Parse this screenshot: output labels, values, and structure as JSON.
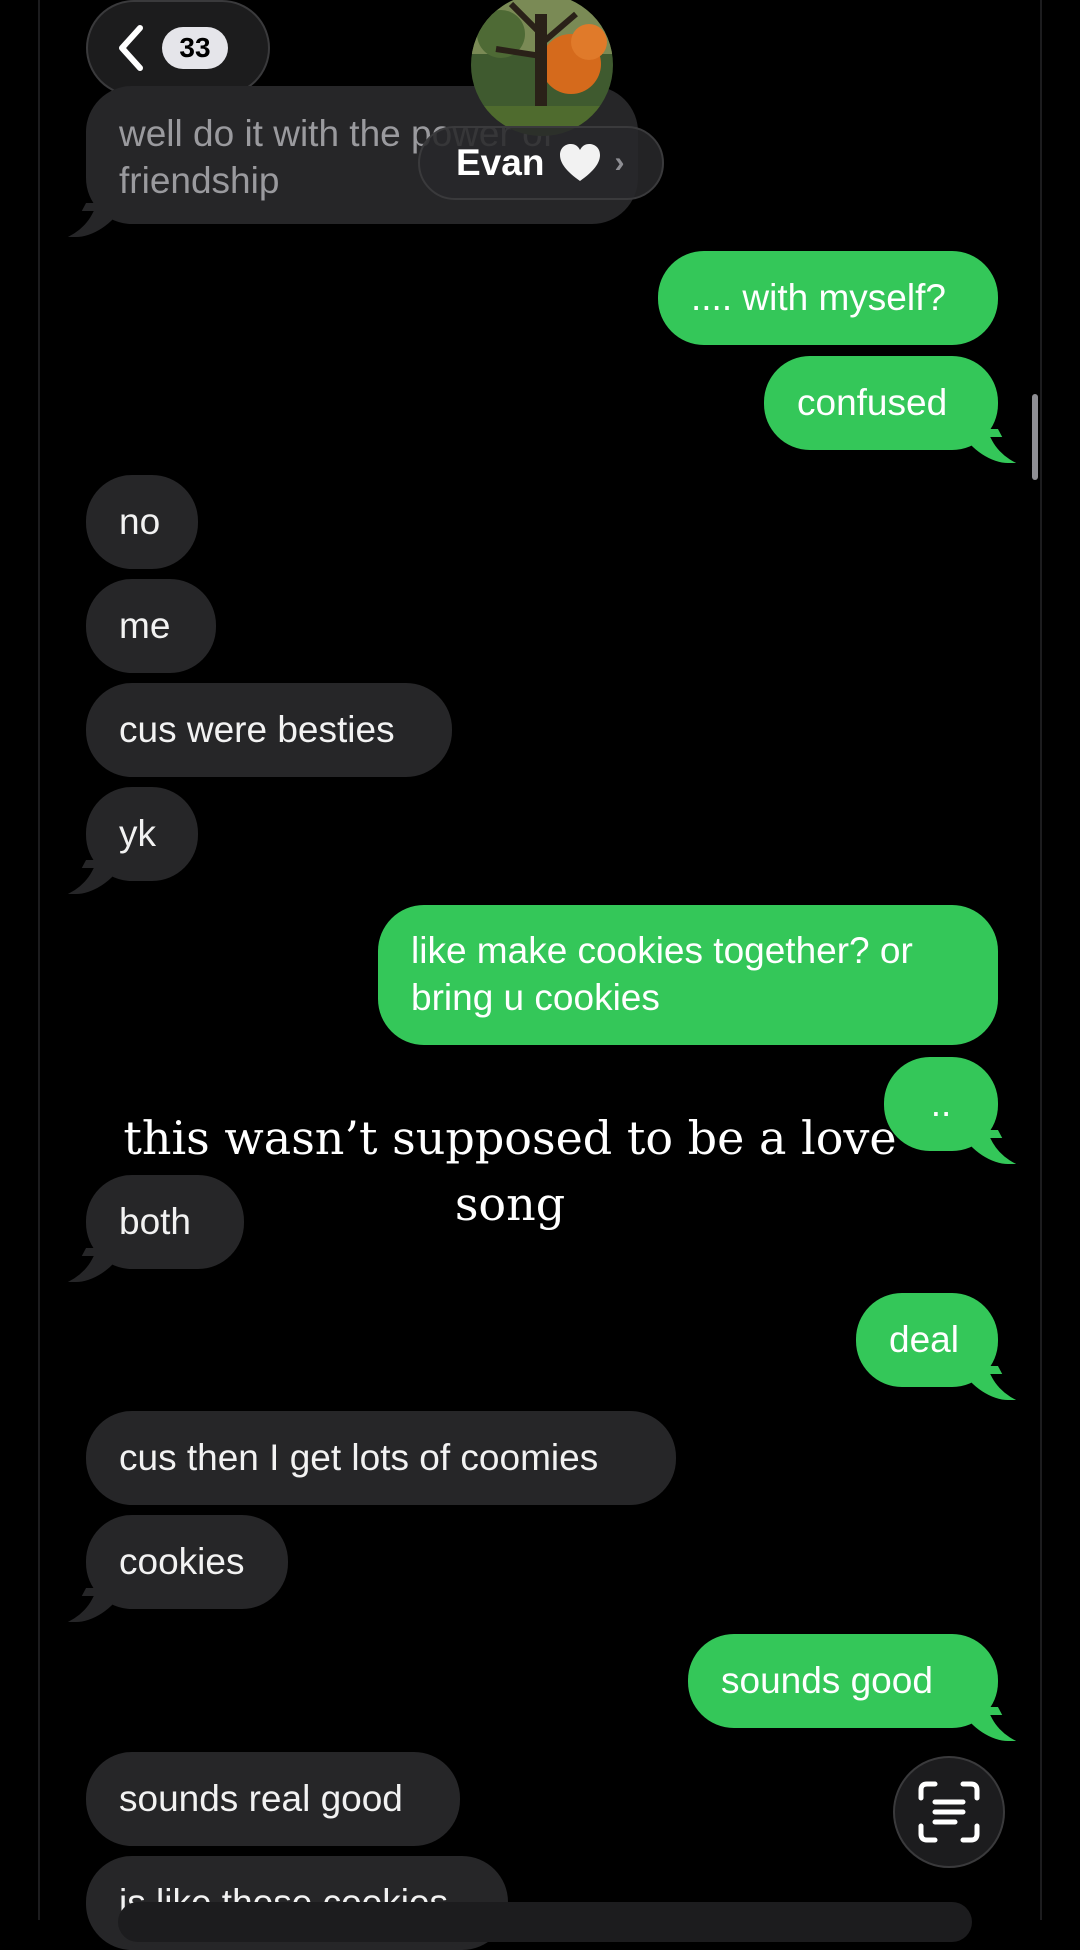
{
  "nav": {
    "unread_count": "33",
    "contact_name": "Evan"
  },
  "messages": [
    {
      "id": "m0",
      "dir": "in",
      "text": "well do it with the power of friendship"
    },
    {
      "id": "m1",
      "dir": "out",
      "text": ".... with myself?"
    },
    {
      "id": "m2",
      "dir": "out",
      "text": "confused"
    },
    {
      "id": "m3",
      "dir": "in",
      "text": "no"
    },
    {
      "id": "m4",
      "dir": "in",
      "text": "me"
    },
    {
      "id": "m5",
      "dir": "in",
      "text": "cus were besties"
    },
    {
      "id": "m6",
      "dir": "in",
      "text": "yk"
    },
    {
      "id": "m7",
      "dir": "out",
      "text": "like make cookies together? or bring u cookies"
    },
    {
      "id": "m8",
      "dir": "out",
      "text": ".."
    },
    {
      "id": "m9",
      "dir": "in",
      "text": "both"
    },
    {
      "id": "m10",
      "dir": "out",
      "text": "deal"
    },
    {
      "id": "m11",
      "dir": "in",
      "text": "cus then I get lots of coomies"
    },
    {
      "id": "m12",
      "dir": "in",
      "text": "cookies"
    },
    {
      "id": "m13",
      "dir": "out",
      "text": "sounds good"
    },
    {
      "id": "m14",
      "dir": "in",
      "text": "sounds real good"
    },
    {
      "id": "m15",
      "dir": "in",
      "text": "is like those cookies"
    }
  ],
  "overlay": {
    "caption": "this wasn’t supposed to be a love song"
  },
  "icons": {
    "back": "chevron-left-icon",
    "heart": "white-heart-icon",
    "contact_chevron": "chevron-right-icon",
    "live_text": "live-text-icon"
  },
  "colors": {
    "outgoing_bubble": "#34c759",
    "incoming_bubble": "#262628",
    "background": "#000000"
  }
}
